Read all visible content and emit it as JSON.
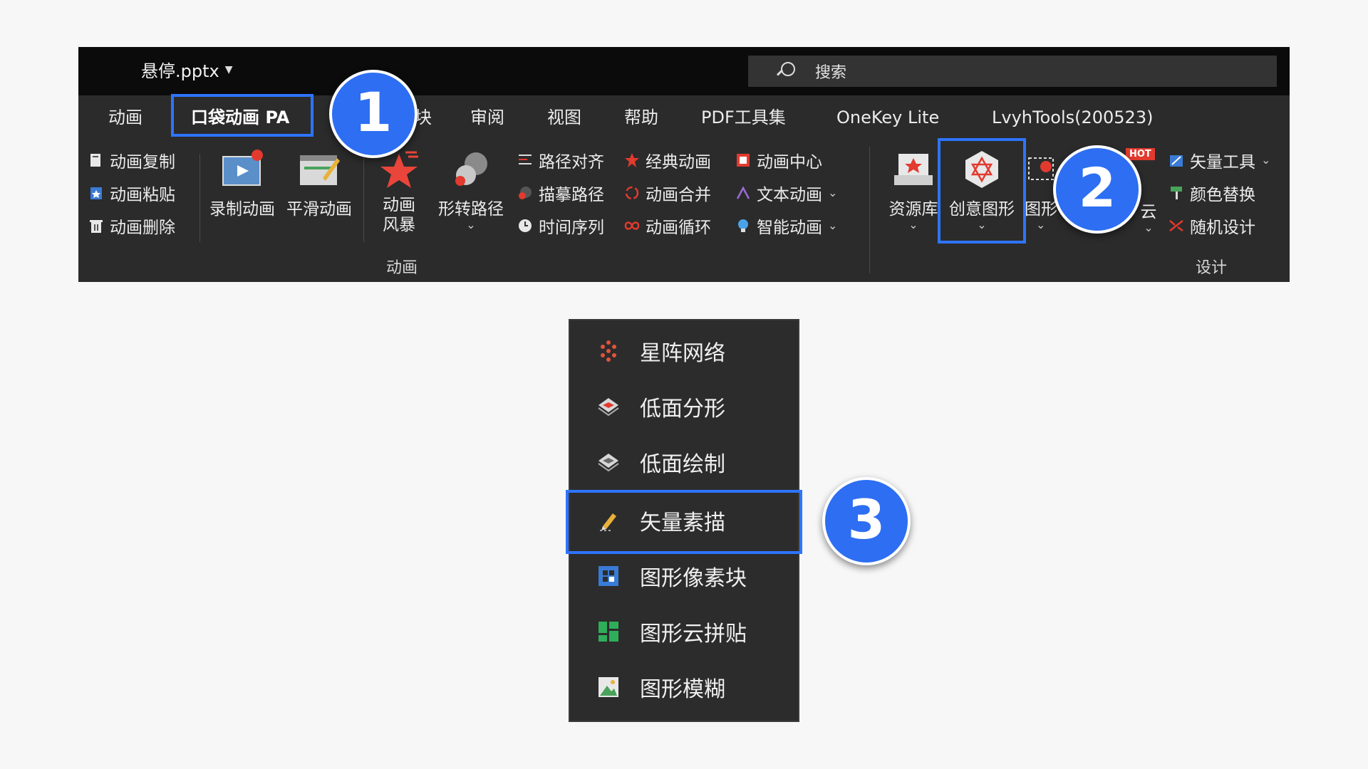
{
  "titlebar": {
    "file_name": "悬停.pptx",
    "search_label": "搜索"
  },
  "tabs": [
    {
      "label": "动画"
    },
    {
      "label": "口袋动画 PA"
    },
    {
      "label": "块"
    },
    {
      "label": "审阅"
    },
    {
      "label": "视图"
    },
    {
      "label": "帮助"
    },
    {
      "label": "PDF工具集"
    },
    {
      "label": "OneKey Lite"
    },
    {
      "label": "LvyhTools(200523)"
    }
  ],
  "ribbon": {
    "clipboard": {
      "copy": "动画复制",
      "paste": "动画粘贴",
      "delete": "动画删除"
    },
    "record": "录制动画",
    "smooth": "平滑动画",
    "storm": {
      "line1": "动画",
      "line2": "风暴"
    },
    "morph_path": "形转路径",
    "col1": {
      "align_path": "路径对齐",
      "trace_path": "描摹路径",
      "timeline": "时间序列"
    },
    "col2": {
      "classic": "经典动画",
      "merge": "动画合并",
      "loop": "动画循环"
    },
    "col3": {
      "center": "动画中心",
      "text_anim": "文本动画",
      "smart": "智能动画"
    },
    "group_animation": "动画",
    "resource": "资源库",
    "creative": "创意图形",
    "shape_partial": "图形",
    "cloud_partial": "云",
    "hot_badge": "HOT",
    "design_col": {
      "vector_tool": "矢量工具",
      "color_replace": "颜色替换",
      "random_design": "随机设计"
    },
    "group_design": "设计"
  },
  "menu": {
    "items": [
      {
        "label": "星阵网络"
      },
      {
        "label": "低面分形"
      },
      {
        "label": "低面绘制"
      },
      {
        "label": "矢量素描"
      },
      {
        "label": "图形像素块"
      },
      {
        "label": "图形云拼贴"
      },
      {
        "label": "图形模糊"
      }
    ]
  },
  "badges": {
    "one": "1",
    "two": "2",
    "three": "3"
  },
  "colors": {
    "highlight": "#2e74ff",
    "badge": "#2d6ef2",
    "ribbon_bg": "#2b2b2b",
    "titlebar_bg": "#0b0b0b"
  }
}
